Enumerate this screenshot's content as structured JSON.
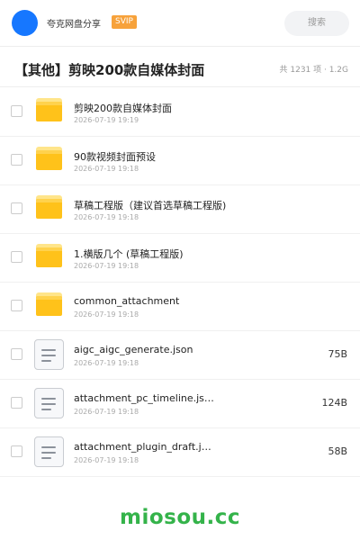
{
  "header": {
    "share_name": "夸克网盘分享",
    "badge": "SVIP",
    "search_label": "搜索"
  },
  "folder": {
    "title": "【其他】剪映200款自媒体封面",
    "summary": "共 1231 项 · 1.2G"
  },
  "items": [
    {
      "type": "folder",
      "name": "剪映200款自媒体封面",
      "date": "2026-07-19 19:19",
      "size": ""
    },
    {
      "type": "folder",
      "name": "90款视频封面预设",
      "date": "2026-07-19 19:18",
      "size": ""
    },
    {
      "type": "folder",
      "name": "草稿工程版（建议首选草稿工程版)",
      "date": "2026-07-19 19:18",
      "size": ""
    },
    {
      "type": "folder",
      "name": "1.横版几个 (草稿工程版)",
      "date": "2026-07-19 19:18",
      "size": ""
    },
    {
      "type": "folder",
      "name": "common_attachment",
      "date": "2026-07-19 19:18",
      "size": ""
    },
    {
      "type": "file",
      "name": "aigc_aigc_generate.json",
      "date": "2026-07-19 19:18",
      "size": "75B"
    },
    {
      "type": "file",
      "name": "attachment_pc_timeline.js…",
      "date": "2026-07-19 19:18",
      "size": "124B"
    },
    {
      "type": "file",
      "name": "attachment_plugin_draft.j…",
      "date": "2026-07-19 19:18",
      "size": "58B"
    }
  ],
  "watermark": "miosou.cc",
  "colors": {
    "avatar": "#1677ff",
    "badge": "#f7a23b",
    "folder": "#ffc21a",
    "watermark": "#34b34a"
  }
}
